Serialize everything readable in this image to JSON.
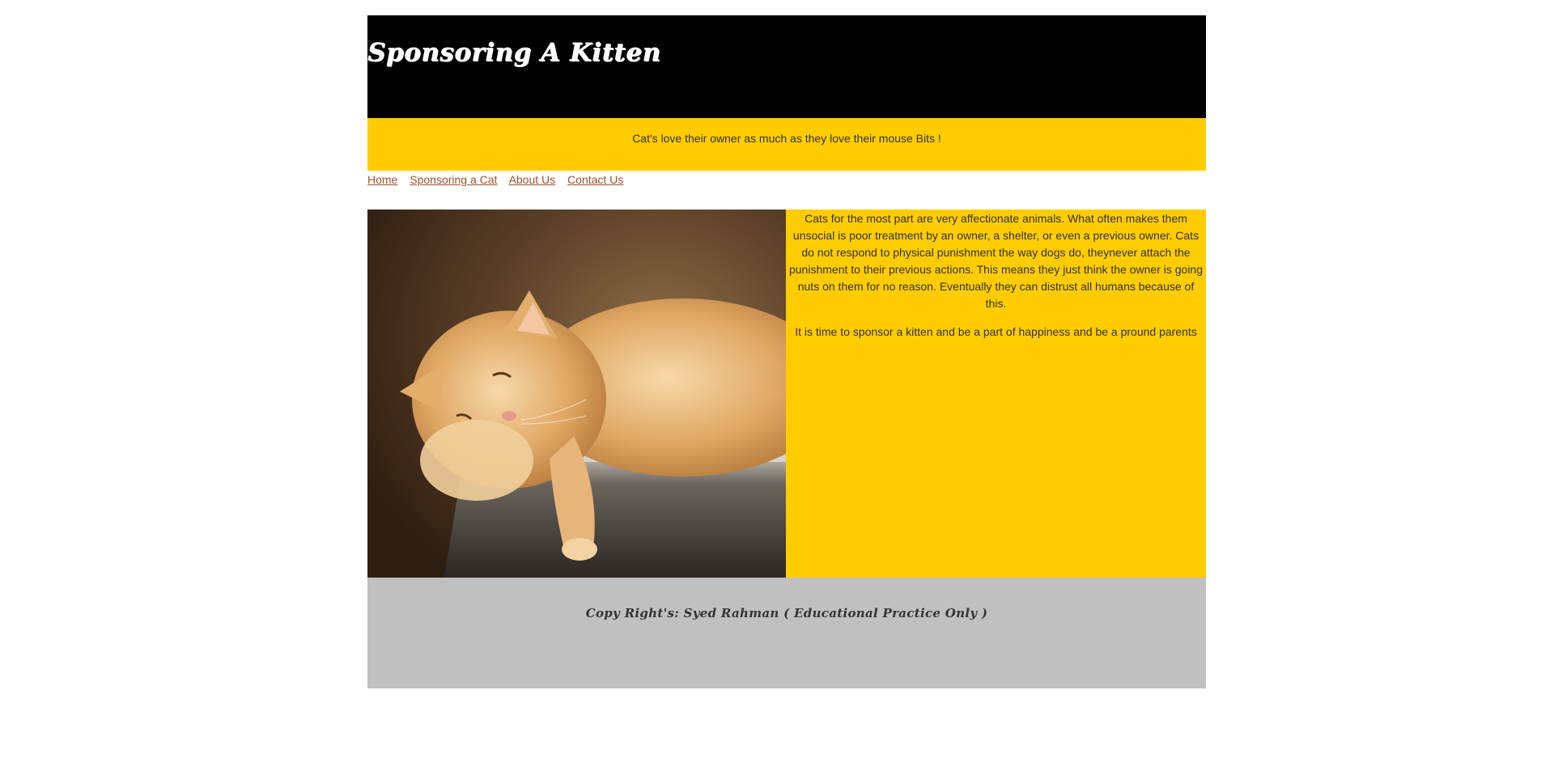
{
  "header": {
    "title": "Sponsoring A Kitten"
  },
  "tagline": "Cat's love their owner as much as they love their mouse Bits !",
  "nav": {
    "items": [
      {
        "label": "Home"
      },
      {
        "label": "Sponsoring a Cat"
      },
      {
        "label": "About Us"
      },
      {
        "label": "Contact Us"
      }
    ]
  },
  "main": {
    "image_icon": "sleeping-cat-photo",
    "paragraphs": [
      "Cats for the most part are very affectionate animals. What often makes them unsocial is poor treatment by an owner, a shelter, or even a previous owner. Cats do not respond to physical punishment the way dogs do, theynever attach the punishment to their previous actions. This means they just think the owner is going nuts on them for no reason. Eventually they can distrust all humans because of this.",
      "It is time to sponsor a kitten and be a part of happiness and be a pround parents"
    ]
  },
  "footer": {
    "text": "Copy Right's: Syed Rahman ( Educational Practice Only )"
  },
  "colors": {
    "header_bg": "#000000",
    "accent_yellow": "#ffcc00",
    "link": "#a0522d",
    "footer_bg": "#c0c0c0"
  }
}
